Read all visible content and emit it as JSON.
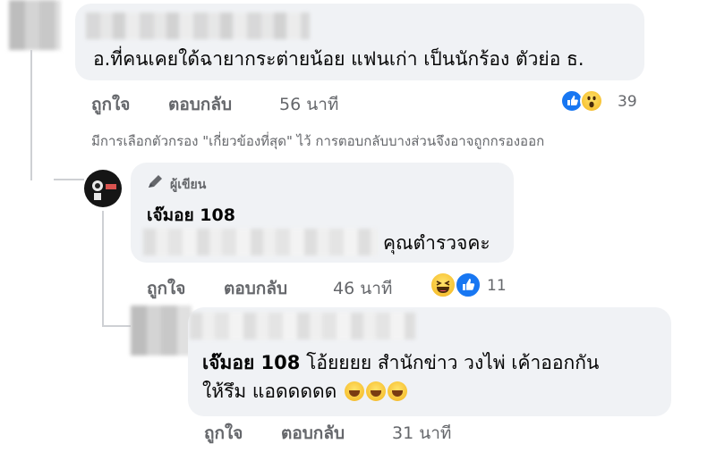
{
  "comment1": {
    "text": "อ.ที่คนเคยใด้ฉายากระต่ายน้อย แฟนเก่า เป็นนักร้อง ตัวย่อ ธ.",
    "like_label": "ถูกใจ",
    "reply_label": "ตอบกลับ",
    "time": "56 นาที",
    "reaction_count": "39",
    "reactions": [
      "like-icon",
      "wow-icon"
    ]
  },
  "filter_notice": "มีการเลือกตัวกรอง \"เกี่ยวข้องที่สุด\" ไว้ การตอบกลับบางส่วนจึงอาจถูกกรองออก",
  "reply1": {
    "badge": "ผู้เขียน",
    "author": "เจ๊มอย 108",
    "text_suffix": "คุณตำรวจคะ",
    "like_label": "ถูกใจ",
    "reply_label": "ตอบกลับ",
    "time": "46 นาที",
    "reaction_count": "11",
    "reactions": [
      "haha-icon",
      "like-icon"
    ]
  },
  "reply2": {
    "mention": "เจ๊มอย 108",
    "text_line1": " โอ้ยยยย สำนักข่าว วงไพ่ เค้าออกกัน",
    "text_line2": "ให้รึม แอดดดดด",
    "inline_emojis": [
      "face-with-tears-of-joy-icon",
      "face-with-tears-of-joy-icon",
      "face-with-tears-of-joy-icon"
    ],
    "like_label": "ถูกใจ",
    "reply_label": "ตอบกลับ",
    "time": "31 นาที"
  },
  "colors": {
    "bubble": "#f0f2f5",
    "secondary_text": "#65676b",
    "thread_line": "#ced0d4",
    "like_blue": "#1877f2"
  }
}
